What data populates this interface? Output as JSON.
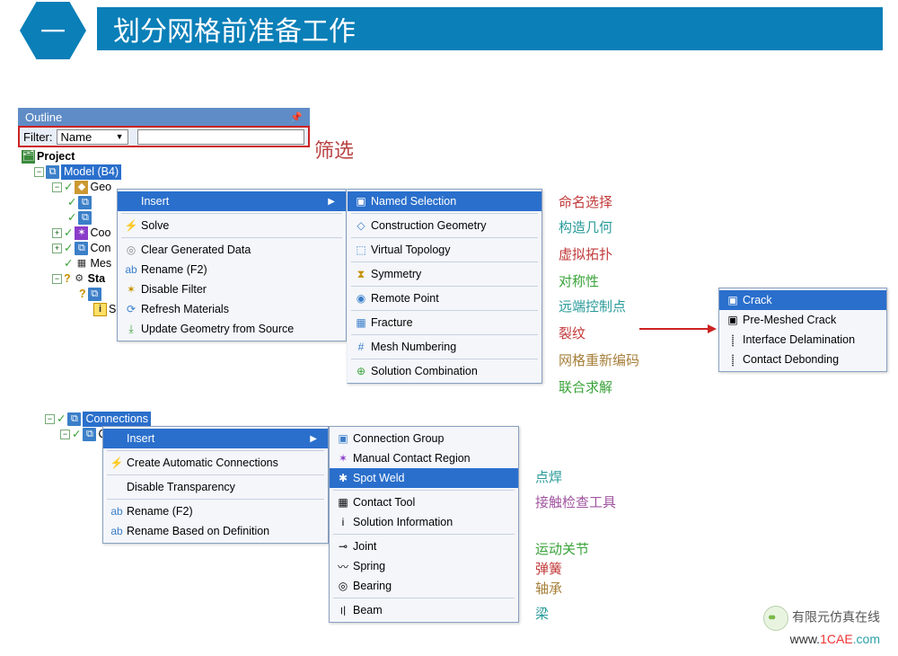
{
  "header": {
    "badge": "一",
    "title": "划分网格前准备工作"
  },
  "outline": {
    "title": "Outline",
    "filter_label": "Filter:",
    "filter_value": "Name"
  },
  "filter_annotation": "筛选",
  "tree": {
    "project": "Project",
    "model": "Model (B4)",
    "geo": "Geo",
    "coord": "Coo",
    "conn": "Con",
    "mesh": "Mes",
    "static": "Sta",
    "solinfo": "Solution Information"
  },
  "ctx1": {
    "insert": "Insert",
    "solve": "Solve",
    "clear": "Clear Generated Data",
    "rename": "Rename (F2)",
    "disable_filter": "Disable Filter",
    "refresh": "Refresh Materials",
    "update_geom": "Update Geometry from Source"
  },
  "insert1": {
    "named_sel": "Named Selection",
    "constr_geom": "Construction Geometry",
    "virt_topo": "Virtual Topology",
    "symmetry": "Symmetry",
    "remote_point": "Remote Point",
    "fracture": "Fracture",
    "mesh_num": "Mesh Numbering",
    "sol_combo": "Solution Combination"
  },
  "annot1": {
    "named_sel": "命名选择",
    "constr_geom": "构造几何",
    "virt_topo": "虚拟拓扑",
    "symmetry": "对称性",
    "remote_point": "远端控制点",
    "fracture": "裂纹",
    "mesh_num": "网格重新编码",
    "sol_combo": "联合求解"
  },
  "fracture_sub": {
    "crack": "Crack",
    "premesh": "Pre-Meshed Crack",
    "interface": "Interface Delamination",
    "debond": "Contact Debonding"
  },
  "tree2": {
    "connections": "Connections",
    "co": "Co"
  },
  "ctx2": {
    "insert": "Insert",
    "create_auto": "Create Automatic Connections",
    "disable_trans": "Disable Transparency",
    "rename": "Rename (F2)",
    "rename_def": "Rename Based on Definition"
  },
  "insert2": {
    "conn_group": "Connection Group",
    "manual_contact": "Manual Contact Region",
    "spot_weld": "Spot Weld",
    "contact_tool": "Contact Tool",
    "sol_info": "Solution Information",
    "joint": "Joint",
    "spring": "Spring",
    "bearing": "Bearing",
    "beam": "Beam"
  },
  "annot2": {
    "spot_weld": "点焊",
    "contact_tool": "接触检查工具",
    "joint": "运动关节",
    "spring": "弹簧",
    "bearing": "轴承",
    "beam": "梁"
  },
  "footer": {
    "brand": "有限元仿真在线",
    "url_pre": "www.",
    "url_mid": "1CAE",
    "url_post": ".com"
  }
}
